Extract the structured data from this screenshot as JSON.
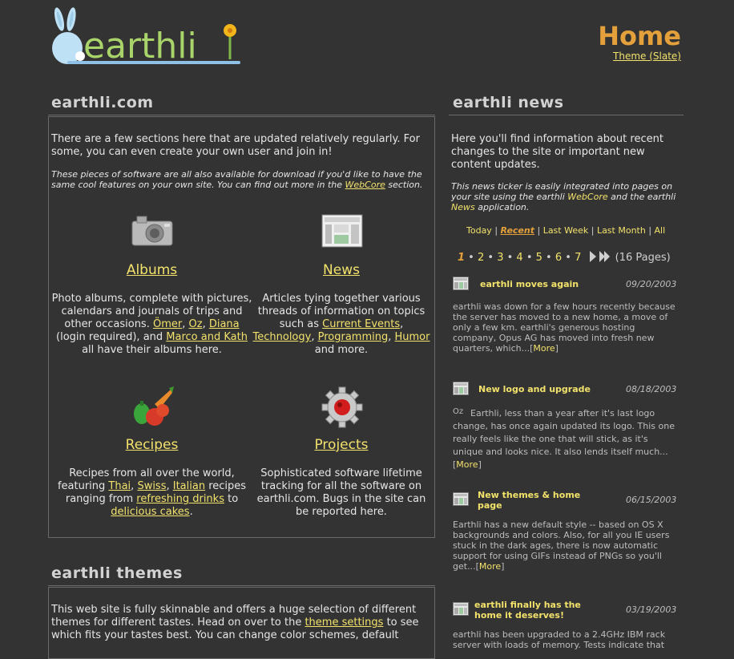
{
  "header": {
    "logo_text": "earthli",
    "page_title": "Home",
    "theme_link": "Theme (Slate)"
  },
  "left": {
    "section_title": "earthli.com",
    "intro": "There are a few sections here that are updated relatively regularly. For some, you can even create your own user and join in!",
    "intro_italic_pre": "These pieces of software are all also available for download if you'd like to have the same cool features on your own site. You can find out more in the ",
    "intro_italic_link": "WebCore",
    "intro_italic_post": " section.",
    "albums": {
      "title": "Albums",
      "t1": "Photo albums, complete with pictures, calendars and journals of trips and other occasions. ",
      "l1": "Ömer",
      "s1": ", ",
      "l2": "Oz",
      "s2": ", ",
      "l3": "Diana",
      "s3": " (login required), and ",
      "l4": "Marco and Kath",
      "s4": " all have their albums here."
    },
    "news": {
      "title": "News",
      "t1": "Articles tying together various threads of information on topics such as ",
      "l1": "Current Events",
      "s1": ", ",
      "l2": "Technology",
      "s2": ", ",
      "l3": "Programming",
      "s3": ", ",
      "l4": "Humor",
      "s4": " and more."
    },
    "recipes": {
      "title": "Recipes",
      "t1": "Recipes from all over the world, featuring ",
      "l1": "Thai",
      "s1": ", ",
      "l2": "Swiss",
      "s2": ", ",
      "l3": "Italian",
      "s3": " recipes ranging from ",
      "l4": "refreshing drinks",
      "s4": " to ",
      "l5": "delicious cakes",
      "s5": "."
    },
    "projects": {
      "title": "Projects",
      "t1": "Sophisticated software lifetime tracking for all the software on earthli.com. Bugs in the site can be reported here."
    },
    "themes_title": "earthli themes",
    "themes_pre": "This web site is fully skinnable and offers a huge selection of different themes for different tastes. Head on over to the ",
    "themes_link": "theme settings",
    "themes_post": " to see which fits your tastes best. You can change color schemes, default"
  },
  "right": {
    "section_title": "earthli news",
    "intro": "Here you'll find information about recent changes to the site or important new content updates.",
    "italic_pre": "This news ticker is easily integrated into pages on your site using the earthli ",
    "italic_link1": "WebCore",
    "italic_mid": " and the earthli ",
    "italic_link2": "News",
    "italic_post": " application.",
    "filters": [
      "Today",
      "Recent",
      "Last Week",
      "Last Month",
      "All"
    ],
    "pages": [
      "1",
      "2",
      "3",
      "4",
      "5",
      "6",
      "7"
    ],
    "pages_count": "(16 Pages)",
    "more": "More",
    "items": [
      {
        "title": "earthli moves again",
        "date": "09/20/2003",
        "body": "earthli was down for a few hours recently because the server has moved to a new home, a move of only a few km. earthli's generous hosting company, Opus AG has moved into fresh new quarters, which..."
      },
      {
        "title": "New logo and upgrade",
        "date": "08/18/2003",
        "avatar": "Oz",
        "body": "Earthli, less than a year after it's last logo change, has once again updated its logo. This one really feels like the one that will stick, as it's unique and looks nice. It also lends itself much..."
      },
      {
        "title": "New themes & home page",
        "date": "06/15/2003",
        "body": "Earthli has a new default style -- based on OS X backgrounds and colors. Also, for all you IE users stuck in the dark ages, there is now automatic support for using GIFs instead of PNGs so you'll get..."
      },
      {
        "title": "earthli finally has the home it deserves!",
        "date": "03/19/2003",
        "body": "earthli has been upgraded to a 2.4GHz IBM rack server with loads of memory. Tests indicate that"
      }
    ]
  },
  "colors": {
    "background": "#333333",
    "link": "#f2e26b",
    "accent": "#e3a03b"
  }
}
